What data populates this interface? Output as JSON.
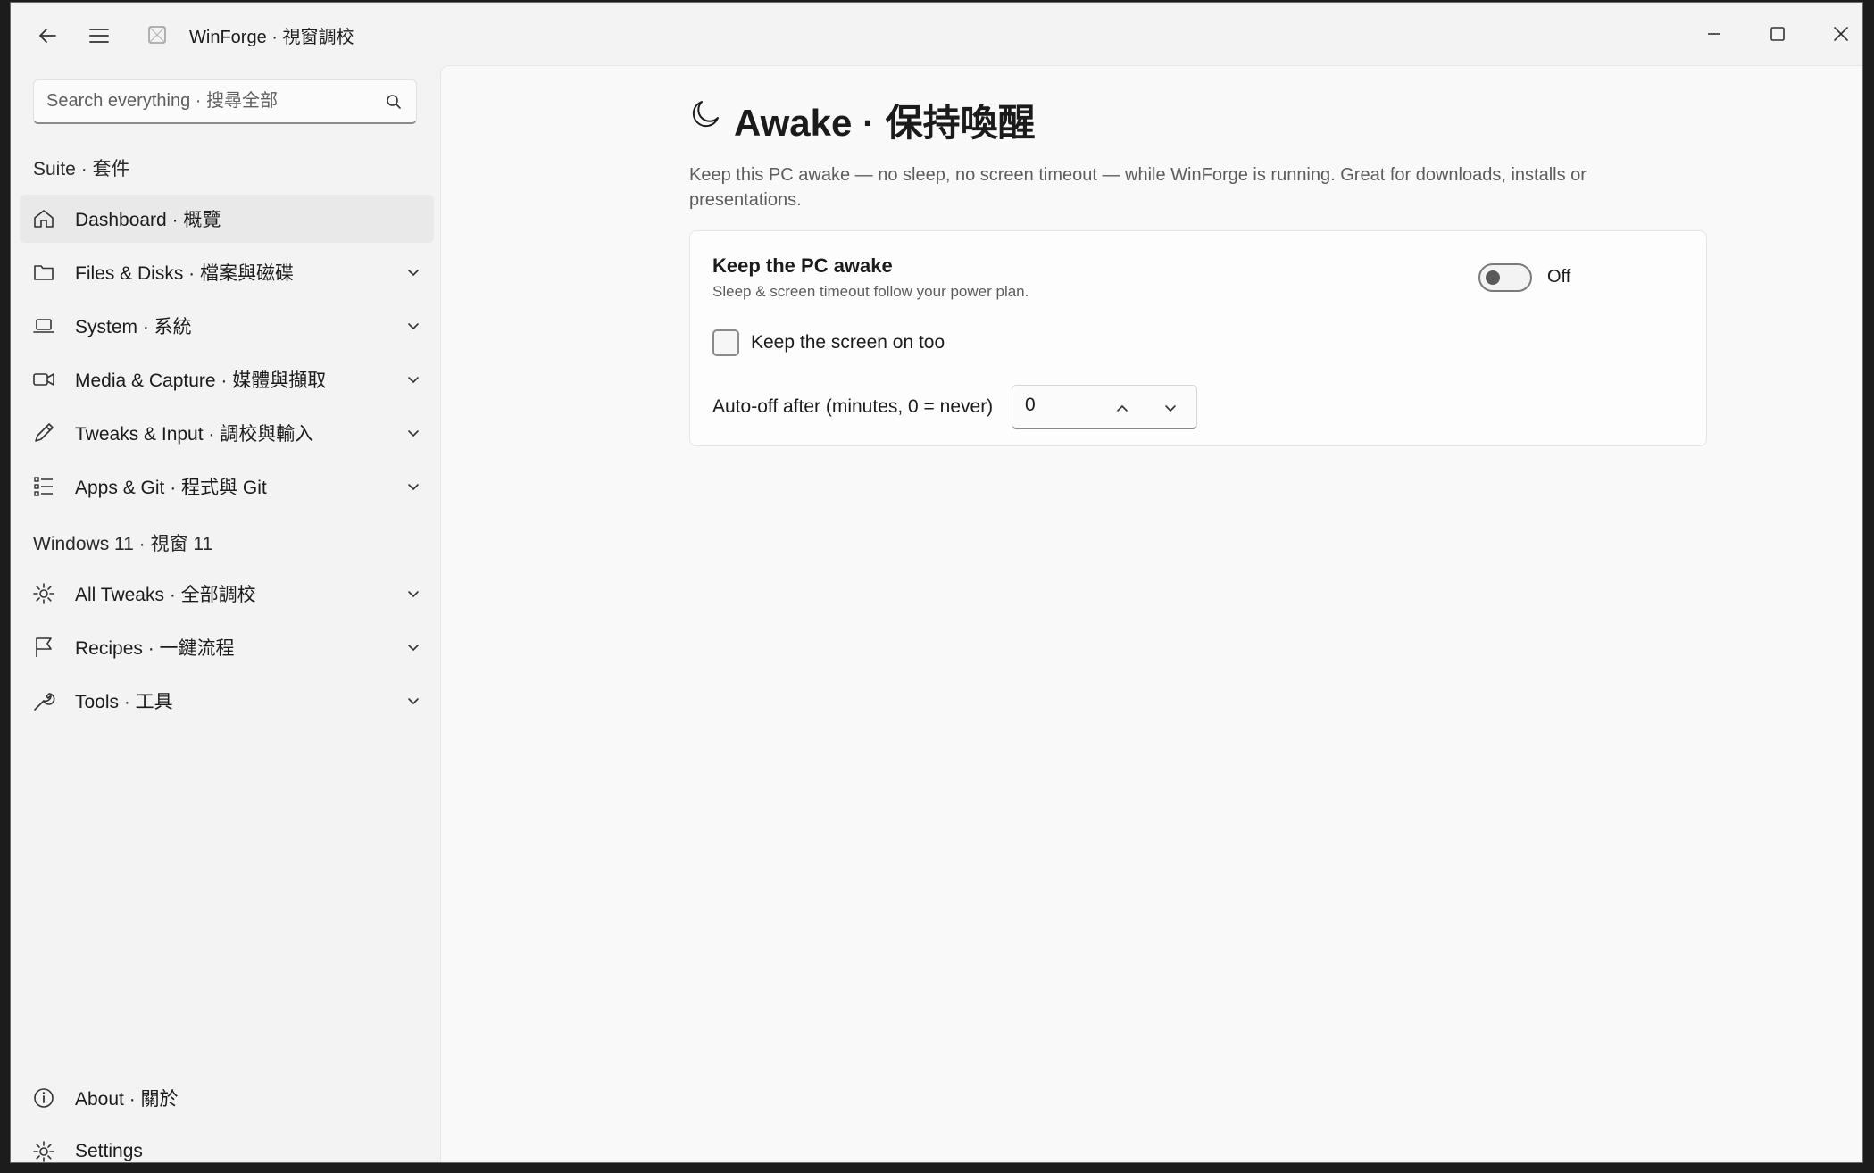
{
  "window": {
    "title": "WinForge · 視窗調校"
  },
  "sidebar": {
    "search_placeholder": "Search everything · 搜尋全部",
    "sections": {
      "suite": "Suite · 套件",
      "windows": "Windows 11 · 視窗 11"
    },
    "items": [
      {
        "label": "Dashboard · 概覽",
        "icon": "home-icon",
        "selected": true
      },
      {
        "label": "Files & Disks · 檔案與磁碟",
        "icon": "folder-icon"
      },
      {
        "label": "System · 系統",
        "icon": "laptop-icon"
      },
      {
        "label": "Media & Capture · 媒體與擷取",
        "icon": "video-camera-icon"
      },
      {
        "label": "Tweaks & Input · 調校與輸入",
        "icon": "pen-icon"
      },
      {
        "label": "Apps & Git · 程式與 Git",
        "icon": "list-icon"
      },
      {
        "label": "All Tweaks · 全部調校",
        "icon": "gear-icon"
      },
      {
        "label": "Recipes · 一鍵流程",
        "icon": "flag-icon"
      },
      {
        "label": "Tools · 工具",
        "icon": "wrench-icon"
      }
    ],
    "footer": [
      {
        "label": "About · 關於",
        "icon": "info-icon"
      },
      {
        "label": "Settings",
        "icon": "gear-icon"
      }
    ]
  },
  "page": {
    "icon": "moon-icon",
    "title": "Awake · 保持喚醒",
    "description": "Keep this PC awake — no sleep, no screen timeout — while WinForge is running. Great for downloads, installs or presentations.",
    "card": {
      "title": "Keep the PC awake",
      "subtitle": "Sleep & screen timeout follow your power plan.",
      "toggle_state": "Off",
      "toggle_on": false,
      "checkbox_label": "Keep the screen on too",
      "checkbox_checked": false,
      "autooff_label": "Auto-off after (minutes, 0 = never)",
      "autooff_value": "0"
    }
  }
}
